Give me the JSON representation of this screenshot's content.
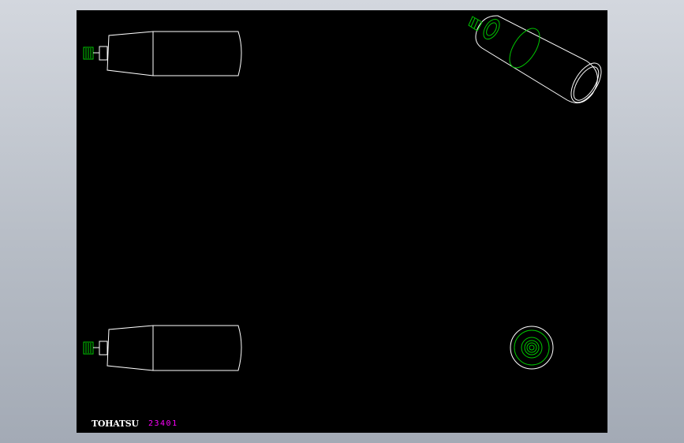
{
  "title_block": {
    "brand": "TOHATSU",
    "drawing_number": "23401"
  },
  "colors": {
    "background": "#000000",
    "outline": "#ffffff",
    "thread": "#00c800",
    "text_number": "#ff00ff"
  },
  "views": [
    {
      "name": "side-view-top"
    },
    {
      "name": "isometric-view"
    },
    {
      "name": "side-view-bottom"
    },
    {
      "name": "end-view"
    }
  ]
}
